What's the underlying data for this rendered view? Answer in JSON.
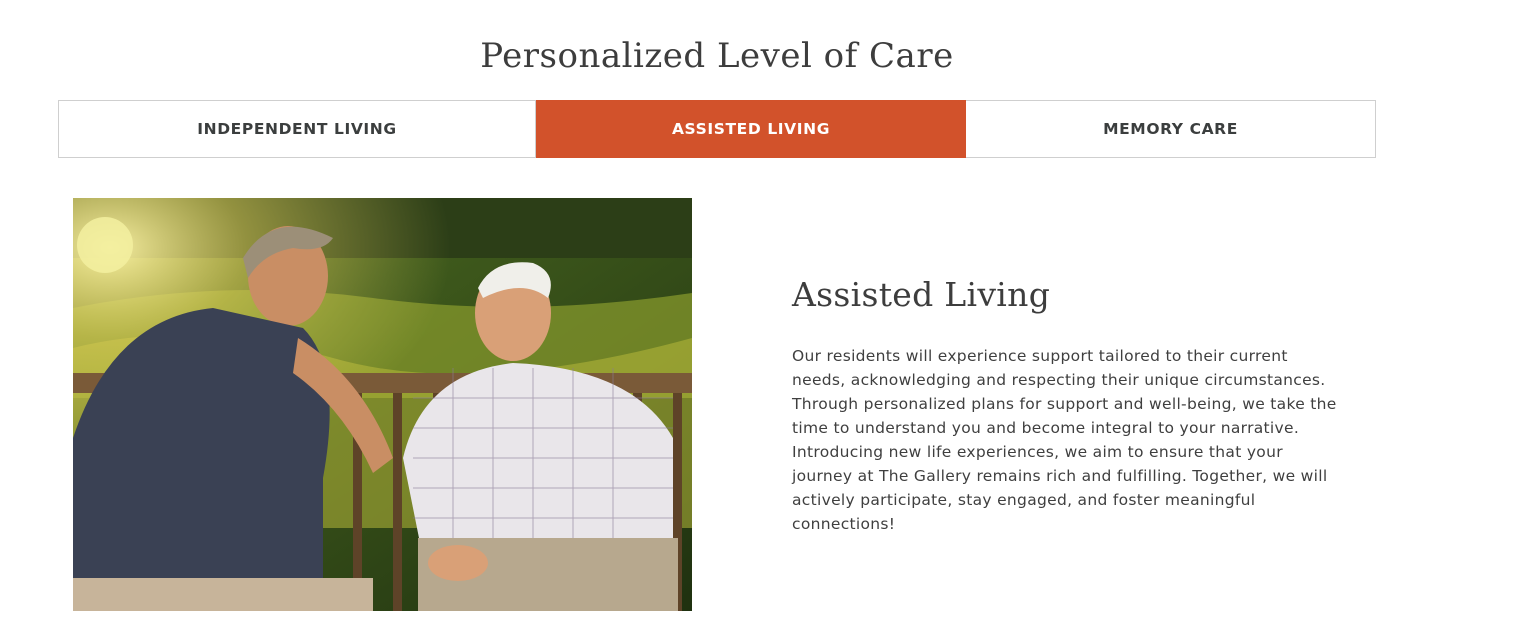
{
  "page": {
    "title": "Personalized Level of Care"
  },
  "tabs": [
    {
      "label": "INDEPENDENT LIVING",
      "active": false
    },
    {
      "label": "ASSISTED LIVING",
      "active": true
    },
    {
      "label": "MEMORY CARE",
      "active": false
    }
  ],
  "panel": {
    "heading": "Assisted Living",
    "body": "Our residents will experience support tailored to their current needs, acknowledging and respecting their unique circumstances. Through personalized plans for support and well-being, we take the time to understand you and become integral to your narrative. Introducing new life experiences, we aim to ensure that your journey at The Gallery remains rich and fulfilling. Together, we will actively participate, stay engaged, and foster meaningful connections!"
  },
  "colors": {
    "accent": "#d2522b",
    "text": "#3d3d3d",
    "tab_border": "#cfcfcf"
  }
}
